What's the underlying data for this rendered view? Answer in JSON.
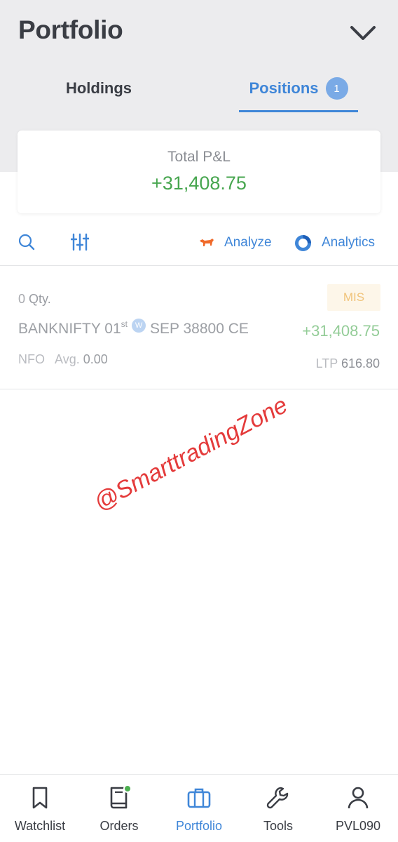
{
  "header": {
    "title": "Portfolio",
    "dropdown_icon": "chevron-down-icon"
  },
  "tabs": [
    {
      "label": "Holdings",
      "active": false
    },
    {
      "label": "Positions",
      "badge": "1",
      "active": true
    }
  ],
  "summary": {
    "label": "Total P&L",
    "value": "+31,408.75"
  },
  "toolbar": {
    "search_icon": "search-icon",
    "filter_icon": "sliders-icon",
    "analyze_label": "Analyze",
    "analytics_label": "Analytics"
  },
  "positions": [
    {
      "qty": "0",
      "qty_label": "Qty.",
      "product": "MIS",
      "symbol": "BANKNIFTY 01",
      "suffix": "st",
      "weekly_badge": "W",
      "contract": "SEP 38800 CE",
      "pnl": "+31,408.75",
      "exchange": "NFO",
      "avg_label": "Avg.",
      "avg_value": "0.00",
      "ltp_label": "LTP",
      "ltp_value": "616.80"
    }
  ],
  "watermark": "@SmarttradingZone",
  "bottom_nav": [
    {
      "label": "Watchlist",
      "icon": "bookmark-icon",
      "active": false
    },
    {
      "label": "Orders",
      "icon": "book-icon",
      "active": false
    },
    {
      "label": "Portfolio",
      "icon": "briefcase-icon",
      "active": true
    },
    {
      "label": "Tools",
      "icon": "wrench-icon",
      "active": false
    },
    {
      "label": "PVL090",
      "icon": "user-icon",
      "active": false
    }
  ],
  "colors": {
    "accent": "#3f86d8",
    "profit": "#47a64f",
    "header_bg": "#ececee",
    "mis_badge_bg": "#fdf6e9",
    "notification_dot": "#4caf50"
  }
}
